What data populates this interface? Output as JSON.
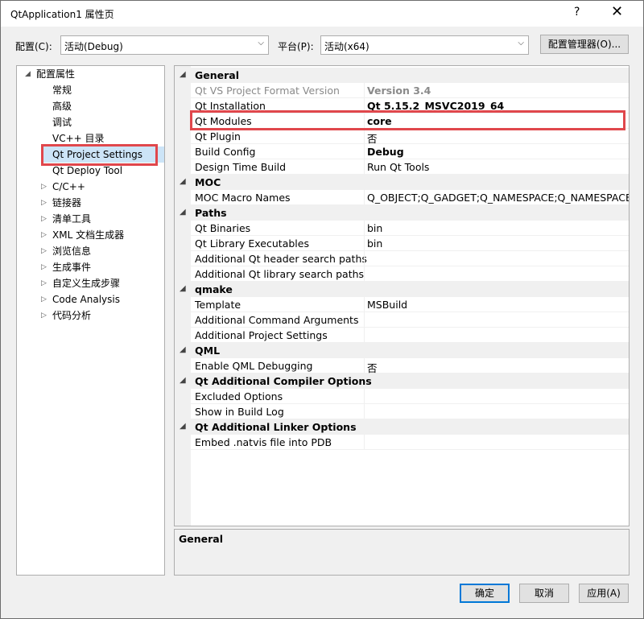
{
  "window": {
    "title": "QtApplication1 属性页",
    "help": "?",
    "close": "✕"
  },
  "config_label": "配置(C):",
  "config_value": "活动(Debug)",
  "platform_label": "平台(P):",
  "platform_value": "活动(x64)",
  "config_manager": "配置管理器(O)...",
  "tree": {
    "root": "配置属性",
    "items": [
      "常规",
      "高级",
      "调试",
      "VC++ 目录",
      "Qt Project Settings",
      "Qt Deploy Tool"
    ],
    "groups": [
      "C/C++",
      "链接器",
      "清单工具",
      "XML 文档生成器",
      "浏览信息",
      "生成事件",
      "自定义生成步骤",
      "Code Analysis",
      "代码分析"
    ]
  },
  "grid": {
    "general": {
      "name": "General",
      "rows": [
        {
          "name": "Qt VS Project Format Version",
          "value": "Version 3.4"
        },
        {
          "name": "Qt Installation",
          "value": "Qt 5.15.2_MSVC2019_64"
        },
        {
          "name": "Qt Modules",
          "value": "core"
        },
        {
          "name": "Qt Plugin",
          "value": "否"
        },
        {
          "name": "Build Config",
          "value": "Debug"
        },
        {
          "name": "Design Time Build",
          "value": "Run Qt Tools"
        }
      ]
    },
    "moc": {
      "name": "MOC",
      "rows": [
        {
          "name": "MOC Macro Names",
          "value": "Q_OBJECT;Q_GADGET;Q_NAMESPACE;Q_NAMESPACE_EX"
        }
      ]
    },
    "paths": {
      "name": "Paths",
      "rows": [
        {
          "name": "Qt Binaries",
          "value": "bin"
        },
        {
          "name": "Qt Library Executables",
          "value": "bin"
        },
        {
          "name": "Additional Qt header search paths",
          "value": ""
        },
        {
          "name": "Additional Qt library search paths",
          "value": ""
        }
      ]
    },
    "qmake": {
      "name": "qmake",
      "rows": [
        {
          "name": "Template",
          "value": "MSBuild"
        },
        {
          "name": "Additional Command Arguments",
          "value": ""
        },
        {
          "name": "Additional Project Settings",
          "value": ""
        }
      ]
    },
    "qml": {
      "name": "QML",
      "rows": [
        {
          "name": "Enable QML Debugging",
          "value": "否"
        }
      ]
    },
    "compiler": {
      "name": "Qt Additional Compiler Options",
      "rows": [
        {
          "name": "Excluded Options",
          "value": ""
        },
        {
          "name": "Show in Build Log",
          "value": ""
        }
      ]
    },
    "linker": {
      "name": "Qt Additional Linker Options",
      "rows": [
        {
          "name": "Embed .natvis file into PDB",
          "value": ""
        }
      ]
    }
  },
  "description": {
    "title": "General"
  },
  "buttons": {
    "ok": "确定",
    "cancel": "取消",
    "apply": "应用(A)"
  },
  "colors": {
    "highlight": "#e0474c",
    "selection": "#cce4f7",
    "accent": "#0078d7"
  }
}
